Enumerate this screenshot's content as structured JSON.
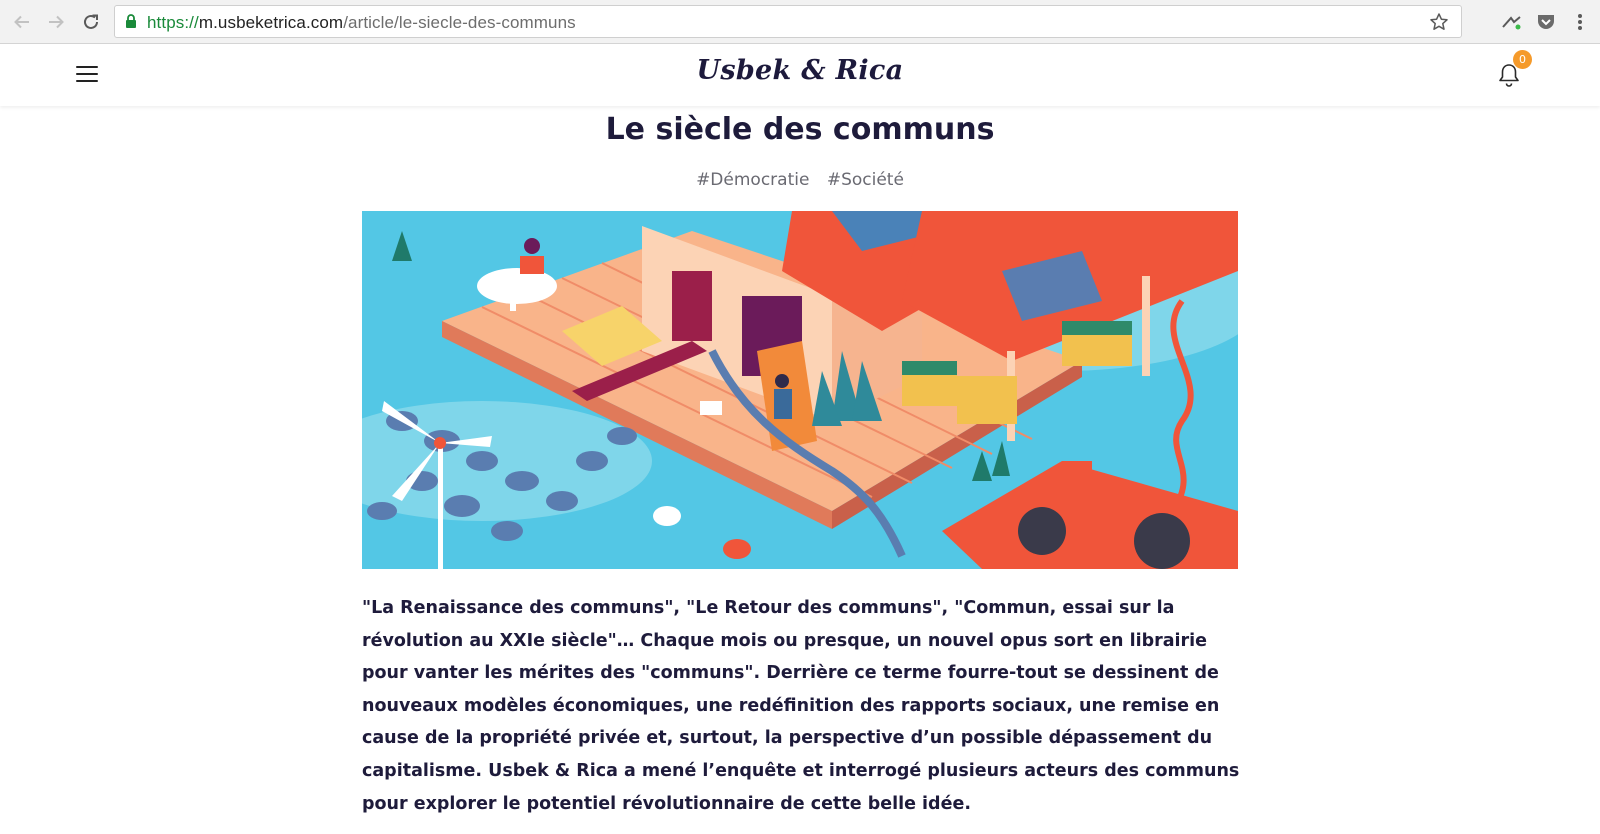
{
  "browser": {
    "url_scheme": "https://",
    "url_host": "m.usbeketrica.com",
    "url_path": "/article/le-siecle-des-communs",
    "icons": [
      "back-arrow-icon",
      "forward-arrow-icon",
      "reload-icon",
      "lock-icon",
      "bookmark-star-icon",
      "extension-icon",
      "pocket-icon",
      "menu-dots-icon"
    ]
  },
  "header": {
    "logo": "Usbek & Rica",
    "notification_count": "0",
    "icons": [
      "hamburger-menu-icon",
      "bell-icon"
    ]
  },
  "article": {
    "title": "Le siècle des communs",
    "tags": [
      "#Démocratie",
      "#Société"
    ],
    "lead": "\"La Renaissance des communs\", \"Le Retour des communs\", \"Commun, essai sur la révolution au XXIe siècle\"… Chaque mois ou presque, un nouvel opus sort en librairie pour vanter les mérites des \"communs\". Derrière ce terme fourre-tout se dessinent de nouveaux modèles économiques, une redéfinition des rapports sociaux, une remise en cause de la propriété privée et, surtout, la perspective d’un possible dépassement du capitalisme. Usbek & Rica a mené l’enquête et interrogé plusieurs acteurs des communs pour explorer le potentiel révolutionnaire de cette belle idée."
  },
  "colors": {
    "brand_navy": "#1e1b3b",
    "badge_orange": "#f59a2a",
    "secure_green": "#1a8a3a",
    "illustration_sky": "#4cc3e3",
    "illustration_coral": "#f0553a",
    "illustration_peach": "#f9b48a"
  }
}
